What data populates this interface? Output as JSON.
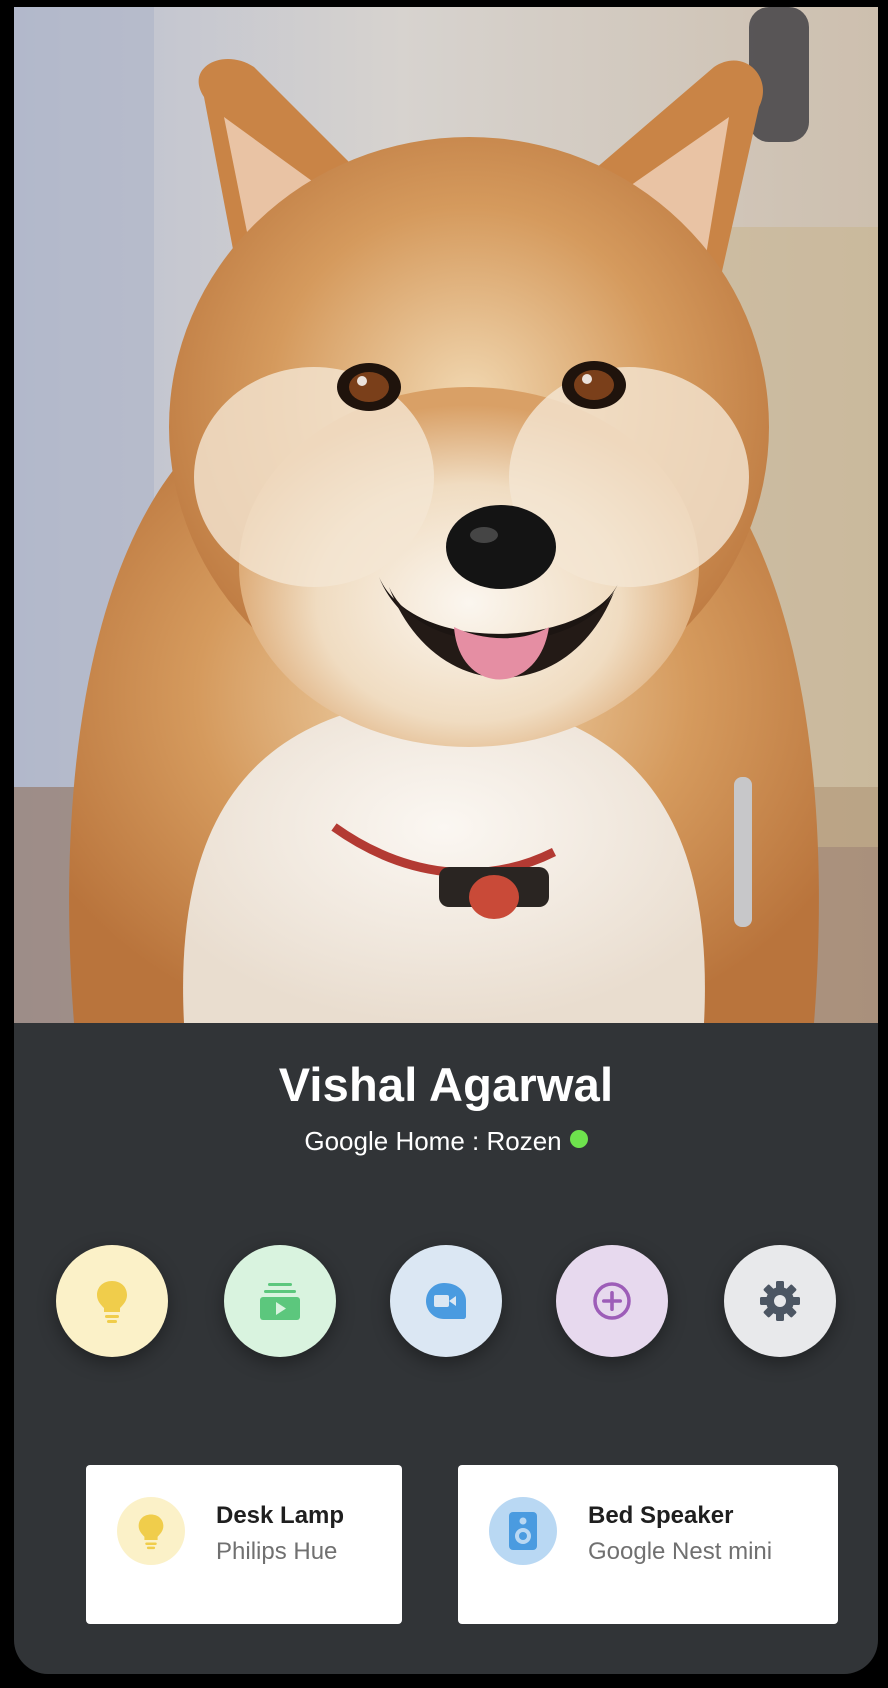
{
  "profile": {
    "name": "Vishal Agarwal",
    "subtitle": "Google Home : Rozen",
    "status": "online"
  },
  "photo": {
    "subject": "shiba-inu"
  },
  "actions": [
    {
      "icon": "lightbulb-icon",
      "bg": "#fbf1c8",
      "fg": "#f0cd4b"
    },
    {
      "icon": "media-play-icon",
      "bg": "#d9f3df",
      "fg": "#5cc77d"
    },
    {
      "icon": "video-camera-icon",
      "bg": "#dbe7f3",
      "fg": "#4a9be0"
    },
    {
      "icon": "add-circle-icon",
      "bg": "#e7d9ee",
      "fg": "#9d5db8"
    },
    {
      "icon": "gear-icon",
      "bg": "#e8e9eb",
      "fg": "#4c5663"
    }
  ],
  "devices": [
    {
      "name": "Desk Lamp",
      "subtitle": "Philips Hue",
      "icon": "lightbulb-icon",
      "icon_bg": "#fbf1c8",
      "icon_fg": "#f0cd4b"
    },
    {
      "name": "Bed Speaker",
      "subtitle": "Google Nest mini",
      "icon": "speaker-icon",
      "icon_bg": "#b9d8f3",
      "icon_fg": "#4a9be0"
    }
  ],
  "colors": {
    "panel": "#313437",
    "online_dot": "#6ee24d"
  }
}
